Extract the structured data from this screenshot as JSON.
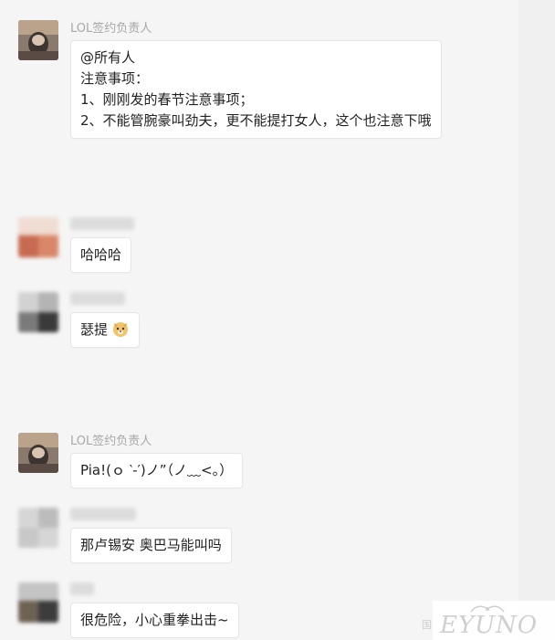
{
  "messages": [
    {
      "sender": "LOL签约负责人",
      "lines": [
        "@所有人",
        "注意事项：",
        "1、刚刚发的春节注意事项；",
        "2、不能管腕豪叫劲夫，更不能提打女人，这个也注意下哦"
      ]
    },
    {
      "sender": "",
      "lines": [
        "哈哈哈"
      ]
    },
    {
      "sender": "",
      "lines": [
        "瑟提"
      ],
      "emoji": "dog-face-emoji"
    },
    {
      "sender": "LOL签约负责人",
      "lines": [
        "Pia!(ｏ ‵-′)ノ”（ノ﹏<。）"
      ]
    },
    {
      "sender": "",
      "lines": [
        "那卢锡安 奥巴马能叫吗"
      ]
    },
    {
      "sender": "",
      "lines": [
        "很危险，小心重拳出击~"
      ]
    }
  ],
  "watermark": {
    "text": "EYUNO",
    "prefix": "国"
  },
  "colors": {
    "background": "#f5f5f5",
    "bubble": "#ffffff",
    "sender": "#a8a8a8"
  }
}
